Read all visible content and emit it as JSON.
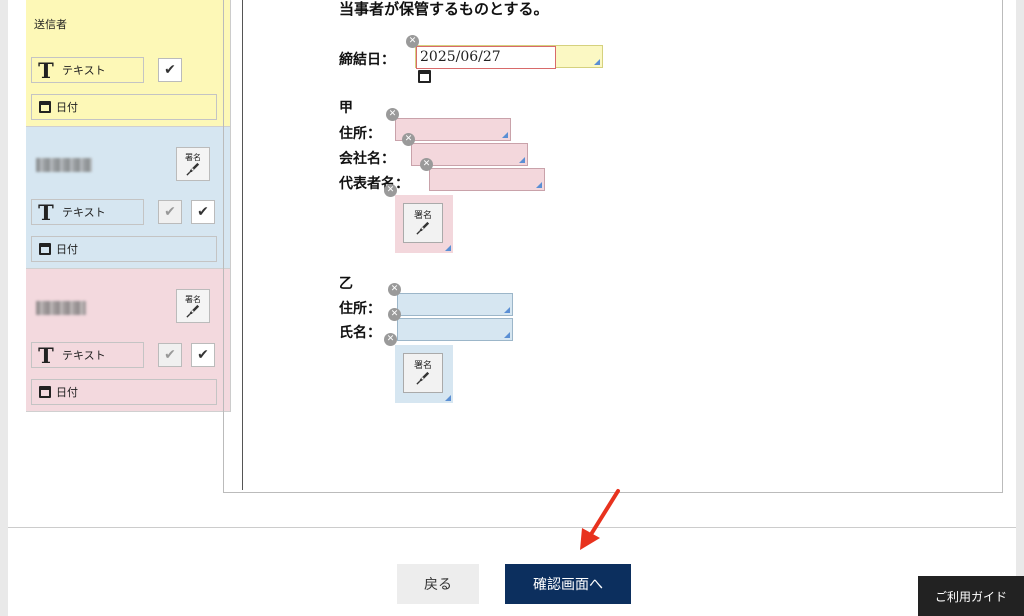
{
  "sidebar": {
    "sender_label": "送信者",
    "text_field_label": "テキスト",
    "date_field_label": "日付",
    "sign_label": "署名"
  },
  "document": {
    "top_text": "当事者が保管するものとする。",
    "conclusion_date_label": "締結日：",
    "conclusion_date_value": "2025/06/27",
    "party_a_heading": "甲",
    "party_a_address_label": "住所：",
    "party_a_company_label": "会社名：",
    "party_a_rep_label": "代表者名：",
    "party_b_heading": "乙",
    "party_b_address_label": "住所：",
    "party_b_name_label": "氏名：",
    "sign_label": "署名"
  },
  "footer": {
    "back_label": "戻る",
    "confirm_label": "確認画面へ",
    "guide_label": "ご利用ガイド"
  },
  "colors": {
    "sender": "#fdf8b7",
    "party_a": "#d6e6f1",
    "party_b": "#f3d9de",
    "primary_button": "#0c2f5e",
    "annotation_arrow": "#e8321e"
  }
}
